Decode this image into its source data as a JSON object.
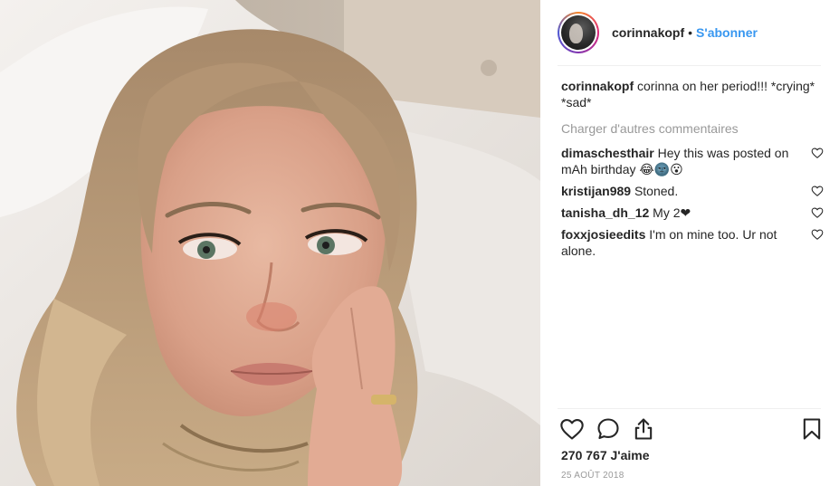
{
  "post": {
    "username": "corinnakopf",
    "separator": "•",
    "follow_label": "S'abonner",
    "caption_user": "corinnakopf",
    "caption_text": "corinna on her period!!! *crying* *sad*",
    "load_more_label": "Charger d'autres commentaires",
    "likes_text": "270 767 J'aime",
    "date_text": "25 AOÛT 2018"
  },
  "comments": [
    {
      "user": "dimaschesthair",
      "text": "Hey this was posted on mAh birthday 😂🌚😮"
    },
    {
      "user": "kristijan989",
      "text": "Stoned."
    },
    {
      "user": "tanisha_dh_12",
      "text": "My 2❤"
    },
    {
      "user": "foxxjosieedits",
      "text": "I'm on mine too. Ur not alone."
    }
  ],
  "icons": {
    "comment_like": "heart-outline-icon",
    "like": "heart-icon",
    "comment": "speech-bubble-icon",
    "share": "share-icon",
    "save": "bookmark-icon"
  },
  "colors": {
    "link_blue": "#3897f0",
    "muted_gray": "#999999",
    "text_dark": "#262626"
  }
}
